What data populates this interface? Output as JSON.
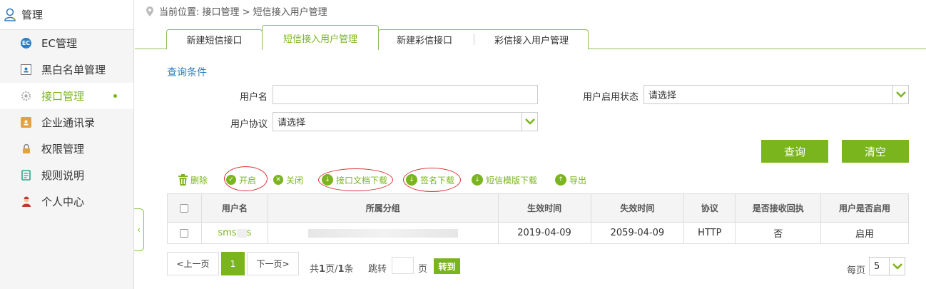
{
  "sidebar": {
    "header": "管理",
    "items": [
      {
        "label": "EC管理",
        "icon": "ec-icon"
      },
      {
        "label": "黑白名单管理",
        "icon": "contact-card-icon"
      },
      {
        "label": "接口管理",
        "icon": "gear-icon",
        "active": true
      },
      {
        "label": "企业通讯录",
        "icon": "address-book-icon"
      },
      {
        "label": "权限管理",
        "icon": "lock-icon"
      },
      {
        "label": "规则说明",
        "icon": "document-icon"
      },
      {
        "label": "个人中心",
        "icon": "person-icon"
      }
    ]
  },
  "breadcrumb": "当前位置: 接口管理 > 短信接入用户管理",
  "tabs": [
    {
      "label": "新建短信接口"
    },
    {
      "label": "短信接入用户管理",
      "active": true
    },
    {
      "label": "新建彩信接口"
    },
    {
      "label": "彩信接入用户管理"
    }
  ],
  "query": {
    "title": "查询条件",
    "username_label": "用户名",
    "username_value": "",
    "status_label": "用户启用状态",
    "status_value": "请选择",
    "protocol_label": "用户协议",
    "protocol_value": "请选择",
    "search_button": "查询",
    "clear_button": "清空"
  },
  "toolbar": {
    "delete": "删除",
    "enable": "开启",
    "disable": "关闭",
    "doc_download": "接口文档下载",
    "sign_download": "签名下载",
    "template_download": "短信模版下载",
    "export": "导出"
  },
  "table": {
    "headers": [
      "用户名",
      "所属分组",
      "生效时间",
      "失效时间",
      "协议",
      "是否接收回执",
      "用户是否启用"
    ],
    "rows": [
      {
        "username": "sms",
        "username_tail": "s",
        "group": "",
        "start": "2019-04-09",
        "end": "2059-04-09",
        "protocol": "HTTP",
        "receipt": "否",
        "enabled": "启用"
      }
    ]
  },
  "pager": {
    "prev": "<上一页",
    "current": "1",
    "next": "下一页>",
    "total_pre": "共",
    "total_pages": "1",
    "total_mid": "页/",
    "total_rows": "1",
    "total_post": "条",
    "jump": "跳转",
    "page_unit": "页",
    "go": "转到",
    "per_page_label": "每页",
    "per_page_value": "5"
  },
  "colors": {
    "accent": "#7ab51d",
    "link": "#2d7ec0",
    "annotation": "#dd3333"
  }
}
